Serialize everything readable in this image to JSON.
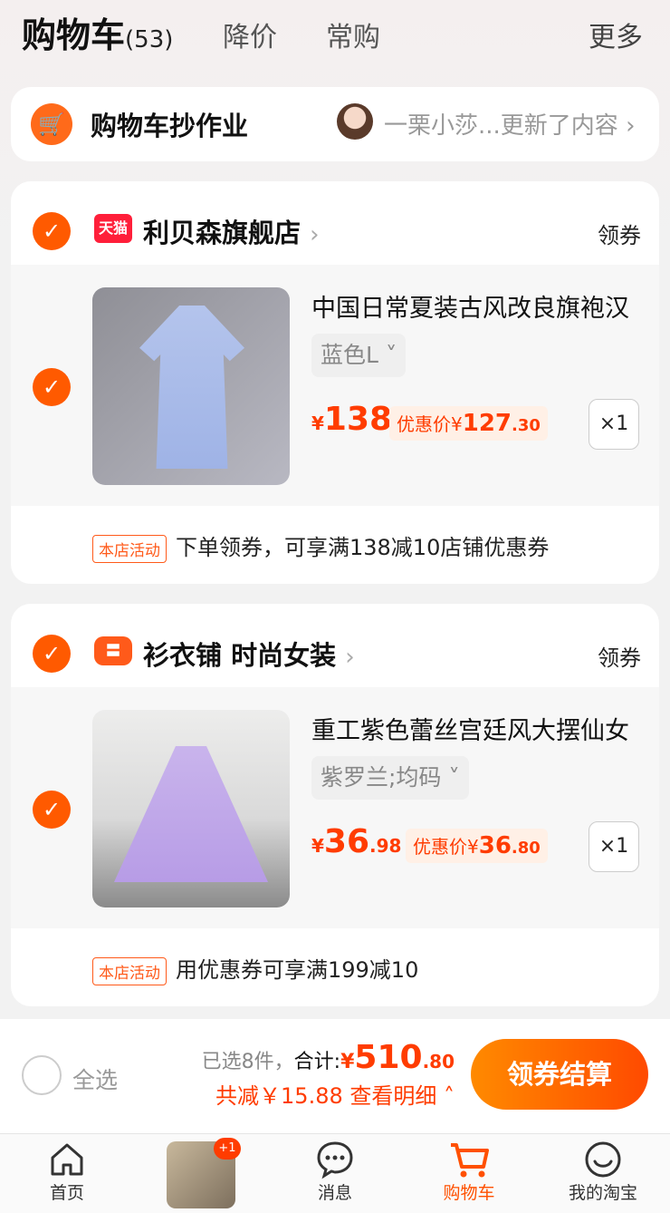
{
  "topbar": {
    "title": "购物车",
    "count": "(53)",
    "tabs": [
      "降价",
      "常购"
    ],
    "more": "更多"
  },
  "homework": {
    "title": "购物车抄作业",
    "update_text": "一栗小莎...更新了内容",
    "chevron": "›"
  },
  "stores": [
    {
      "badge": "天猫",
      "name": "利贝森旗舰店",
      "chevron": "›",
      "coupon": "领券",
      "item": {
        "title": "中国日常夏装古风改良旗袍汉",
        "sku": "蓝色L ˅",
        "price_symbol": "¥",
        "price_int": "138",
        "price_dec": "",
        "promo_label": "优惠价¥",
        "promo_int": "127",
        "promo_dec": ".30",
        "qty": "×1"
      },
      "activity_tag": "本店活动",
      "activity_text": "下单领券，可享满138减10店铺优惠券"
    },
    {
      "badge": "〓",
      "name": "衫衣铺 时尚女装",
      "chevron": "›",
      "coupon": "领券",
      "item": {
        "title": "重工紫色蕾丝宫廷风大摆仙女",
        "sku": "紫罗兰;均码 ˅",
        "price_symbol": "¥",
        "price_int": "36",
        "price_dec": ".98",
        "promo_label": "优惠价¥",
        "promo_int": "36",
        "promo_dec": ".80",
        "qty": "×1"
      },
      "activity_tag": "本店活动",
      "activity_text": "用优惠券可享满199减10"
    }
  ],
  "checkout": {
    "select_all": "全选",
    "selected": "已选8件，",
    "total_label": "合计:",
    "total_symbol": "¥",
    "total_int": "510",
    "total_dec": ".80",
    "discount": "共减￥15.88 查看明细 ˄",
    "button": "领券结算"
  },
  "tabbar": {
    "items": [
      "首页",
      "",
      "消息",
      "购物车",
      "我的淘宝"
    ],
    "badge": "+1"
  },
  "colors": {
    "accent": "#ff5000",
    "price": "#ff3c00",
    "tmall": "#ff1f3a"
  }
}
